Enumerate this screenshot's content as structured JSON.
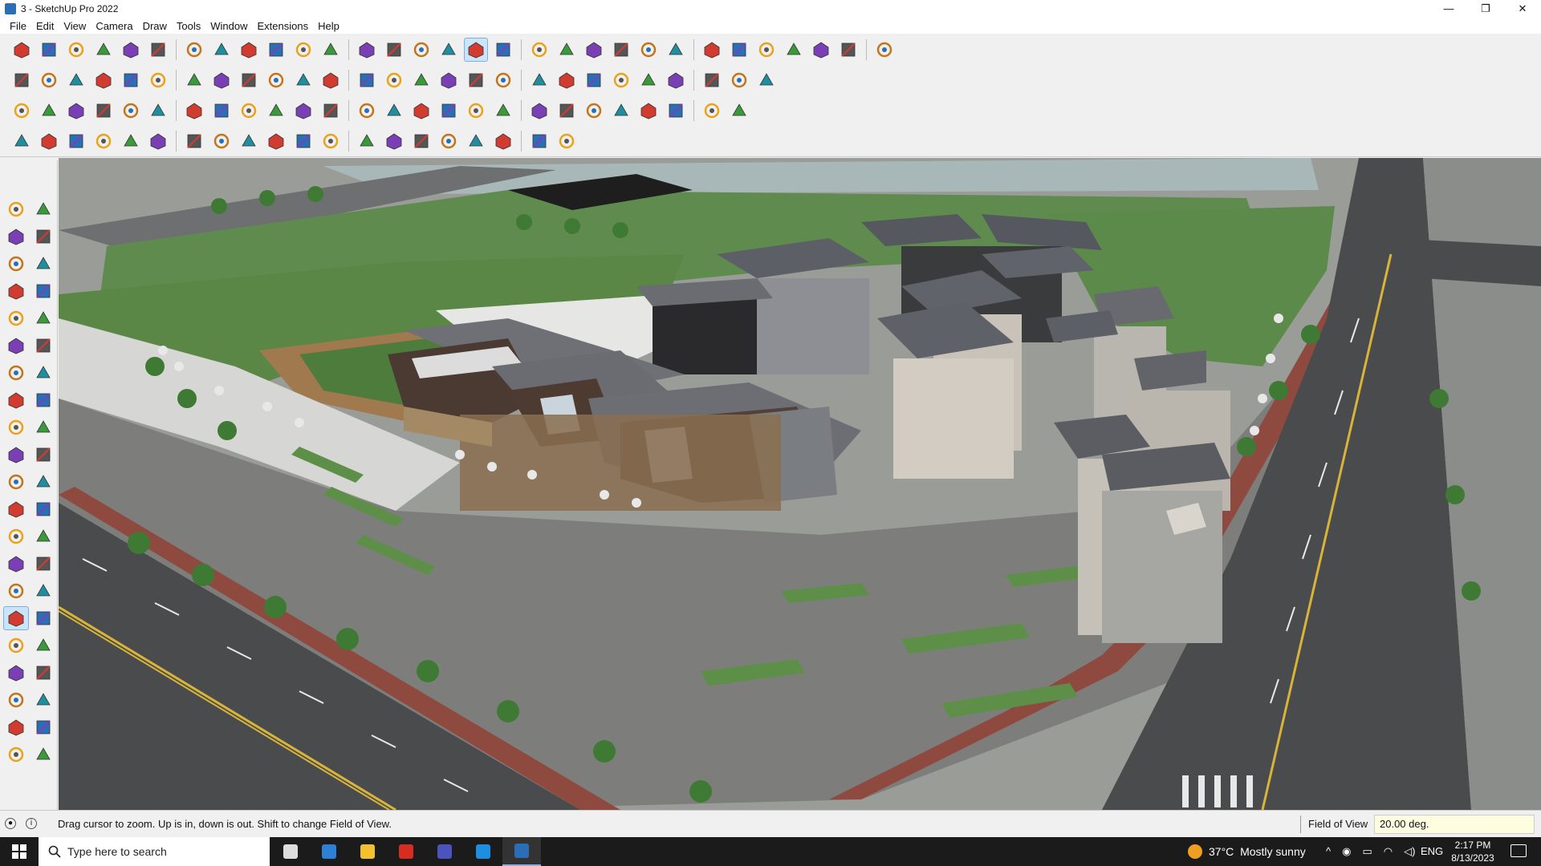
{
  "window": {
    "title": "3 - SketchUp Pro 2022",
    "minimize": "—",
    "maximize": "❐",
    "close": "✕"
  },
  "menu": [
    "File",
    "Edit",
    "View",
    "Camera",
    "Draw",
    "Tools",
    "Window",
    "Extensions",
    "Help"
  ],
  "toolbar_icons": {
    "row1": [
      "zoom-extents-icon",
      "select-icon",
      "eraser-icon",
      "line-icon",
      "arc-icon",
      "rectangle-icon",
      "push-pull-icon",
      "follow-me-icon",
      "move-icon",
      "rotate-icon",
      "scale-icon",
      "tape-measure-icon",
      "text-icon",
      "paint-bucket-icon",
      "orbit-icon",
      "pan-icon",
      "zoom-icon",
      "zoom-window-icon",
      "section-plane-icon",
      "layers-icon",
      "scenes-icon",
      "styles-icon",
      "user-icon",
      "warehouse-icon",
      "extension-warehouse-icon",
      "sandbox-icon",
      "tag-icon",
      "solid-tools-icon",
      "undo-icon",
      "redo-icon",
      "trimble-icon"
    ],
    "row2": [
      "iso-view-icon",
      "top-view-icon",
      "front-view-icon",
      "right-view-icon",
      "back-view-icon",
      "left-view-icon",
      "bottom-view-icon",
      "xray-icon",
      "wireframe-icon",
      "hidden-line-icon",
      "shaded-icon",
      "textured-icon",
      "monochrome-icon",
      "house-icon",
      "house-outline-icon",
      "roof-icon",
      "walls-icon",
      "profile-icon",
      "pencil-icon",
      "shapes-icon",
      "circle-icon",
      "ellipse-icon",
      "polygon-icon",
      "curve-icon",
      "offset-icon",
      "paint-icon",
      "cut-icon"
    ],
    "row3": [
      "solid-union-icon",
      "solid-subtract-icon",
      "solid-trim-icon",
      "solid-intersect-icon",
      "outer-shell-icon",
      "split-icon",
      "component-icon",
      "group-icon",
      "box-icon",
      "explode-icon",
      "weld-icon",
      "extrude-icon",
      "loft-icon",
      "sweep-icon",
      "round-corner-icon",
      "fillet-icon",
      "chamfer-icon",
      "taper-icon",
      "twist-icon",
      "bend-icon",
      "shell-icon",
      "grid-icon",
      "array-icon",
      "mirror-icon",
      "align-icon",
      "distribute-icon"
    ],
    "row4": [
      "draw-line-icon",
      "bezier-icon",
      "spline-icon",
      "snap-icon",
      "gear-shape-icon",
      "stair-icon",
      "rail-icon",
      "panel-icon",
      "column-icon",
      "beam-icon",
      "slab-icon",
      "wall-tool-icon",
      "window-tool-icon",
      "door-tool-icon",
      "roof-tool-icon",
      "frame-icon",
      "truss-icon",
      "fence-icon",
      "hatch-icon",
      "pattern-icon"
    ]
  },
  "left_tools": [
    "select-icon",
    "orbit-hand-icon",
    "paint-bucket-icon",
    "eraser-icon",
    "component-icon",
    "tape-icon",
    "line-icon",
    "freehand-icon",
    "rectangle-icon",
    "rotated-rect-icon",
    "circle-icon",
    "polygon-icon",
    "arc-icon",
    "pie-icon",
    "two-point-arc-icon",
    "three-point-arc-icon",
    "move-icon",
    "push-pull-icon",
    "rotate-icon",
    "follow-me-icon",
    "scale-icon",
    "offset-icon",
    "tape-measure-icon",
    "dimension-icon",
    "protractor-icon",
    "text-icon",
    "axes-icon",
    "3d-text-icon",
    "orbit-icon",
    "pan-icon",
    "zoom-icon",
    "zoom-window-icon",
    "zoom-extents-icon",
    "previous-view-icon",
    "position-camera-icon",
    "look-around-icon",
    "walk-icon",
    "section-plane-icon",
    "section-display-icon",
    "section-cuts-icon",
    "section-fill-icon",
    "layers-icon"
  ],
  "status": {
    "hint": "Drag cursor to zoom.  Up is in, down is out. Shift to change Field of View.",
    "vcb_label": "Field of View",
    "vcb_value": "20.00 deg."
  },
  "taskbar": {
    "search_placeholder": "Type here to search",
    "weather_temp": "37°C",
    "weather_text": "Mostly sunny",
    "lang": "ENG",
    "time": "2:17 PM",
    "date": "8/13/2023",
    "apps": [
      "task-view-icon",
      "calculator-icon",
      "file-explorer-icon",
      "acrobat-icon",
      "teams-icon",
      "edge-icon",
      "sketchup-icon"
    ]
  },
  "colors": {
    "accent": "#cce4f7",
    "taskbar": "#1b1b1b",
    "vcb_bg": "#fffde0"
  }
}
